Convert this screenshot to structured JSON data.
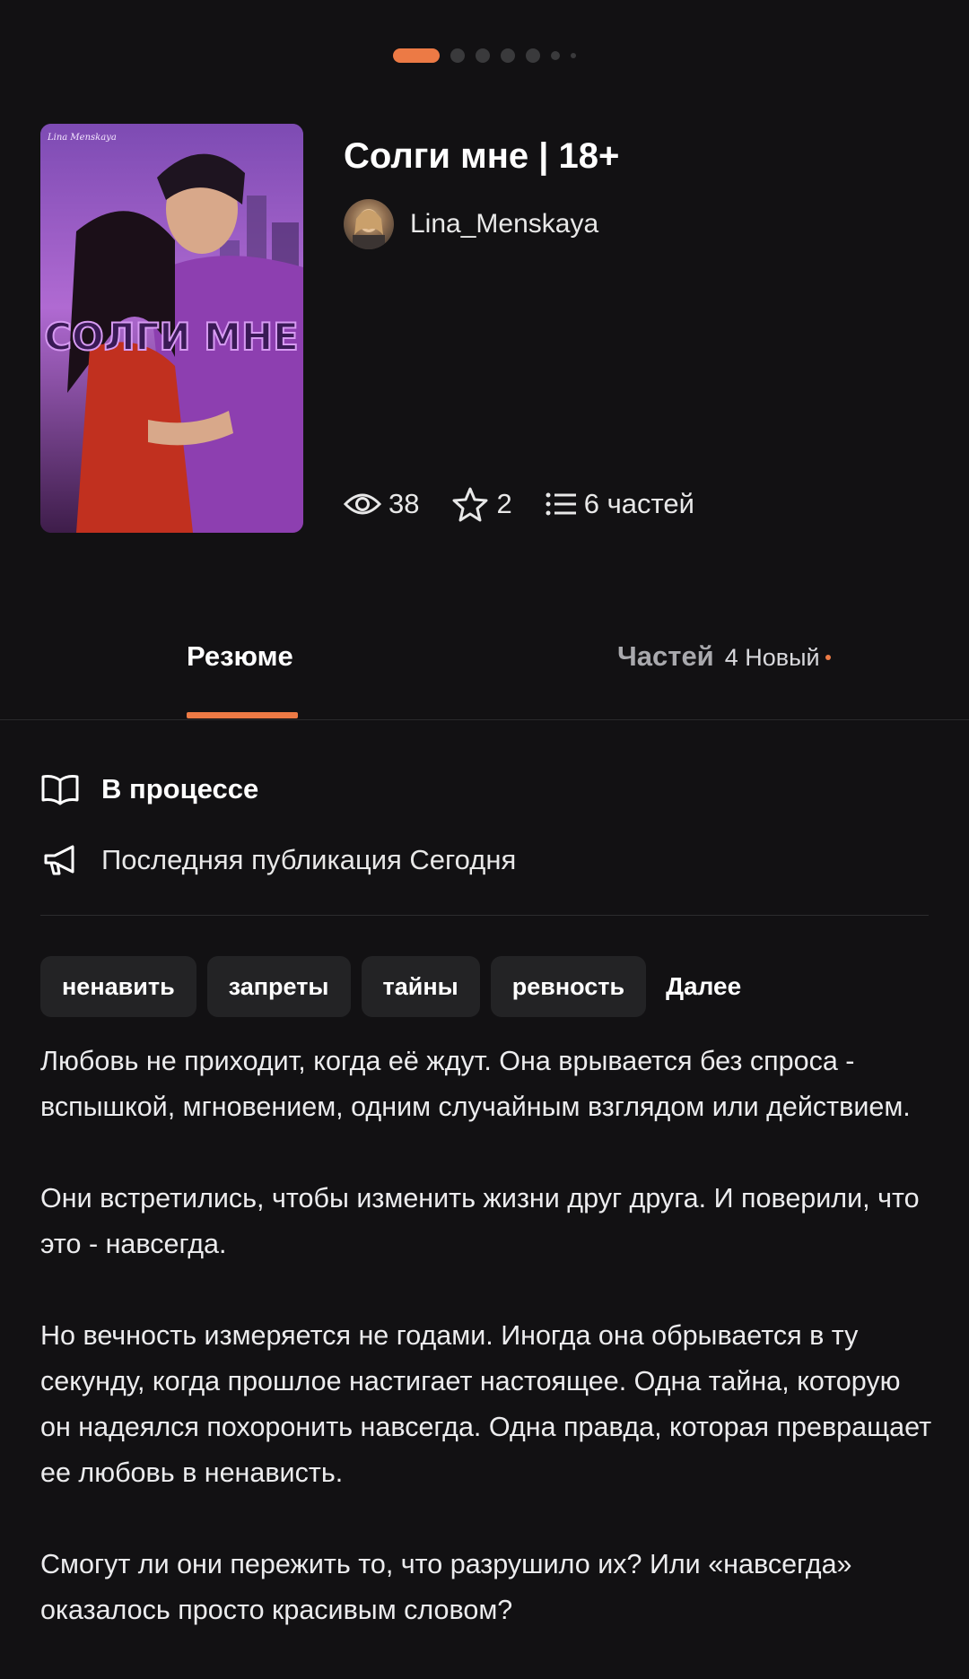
{
  "pager": {
    "total": 7,
    "active_index": 0
  },
  "book": {
    "title": "Солги мне | 18+",
    "cover_text": "СОЛГИ МНЕ",
    "cover_author_sign": "Lina Menskaya"
  },
  "author": {
    "name": "Lina_Menskaya"
  },
  "stats": {
    "views": "38",
    "stars": "2",
    "parts": "6 частей"
  },
  "tabs": {
    "summary": "Резюме",
    "parts": "Частей",
    "parts_new": "4 Новый"
  },
  "status": {
    "progress": "В процессе",
    "last_publication": "Последняя публикация Сегодня"
  },
  "tags": [
    "ненавить",
    "запреты",
    "тайны",
    "ревность"
  ],
  "tags_more": "Далее",
  "description": [
    "Любовь не приходит, когда её ждут. Она врывается без спроса - вспышкой, мгновением, одним случайным взглядом или действием.",
    "Они встретились, чтобы изменить жизни друг друга. И поверили, что это - навсегда.",
    "Но вечность измеряется не годами. Иногда она обрывается в ту секунду, когда прошлое настигает настоящее. Одна тайна, которую он надеялся похоронить навсегда. Одна правда, которая превращает ее любовь в ненависть.",
    "Смогут ли они пережить то, что разрушило их? Или «навсегда» оказалось просто красивым словом?"
  ],
  "colors": {
    "accent": "#ec7a45",
    "background": "#121113",
    "tag_bg": "#232325"
  }
}
